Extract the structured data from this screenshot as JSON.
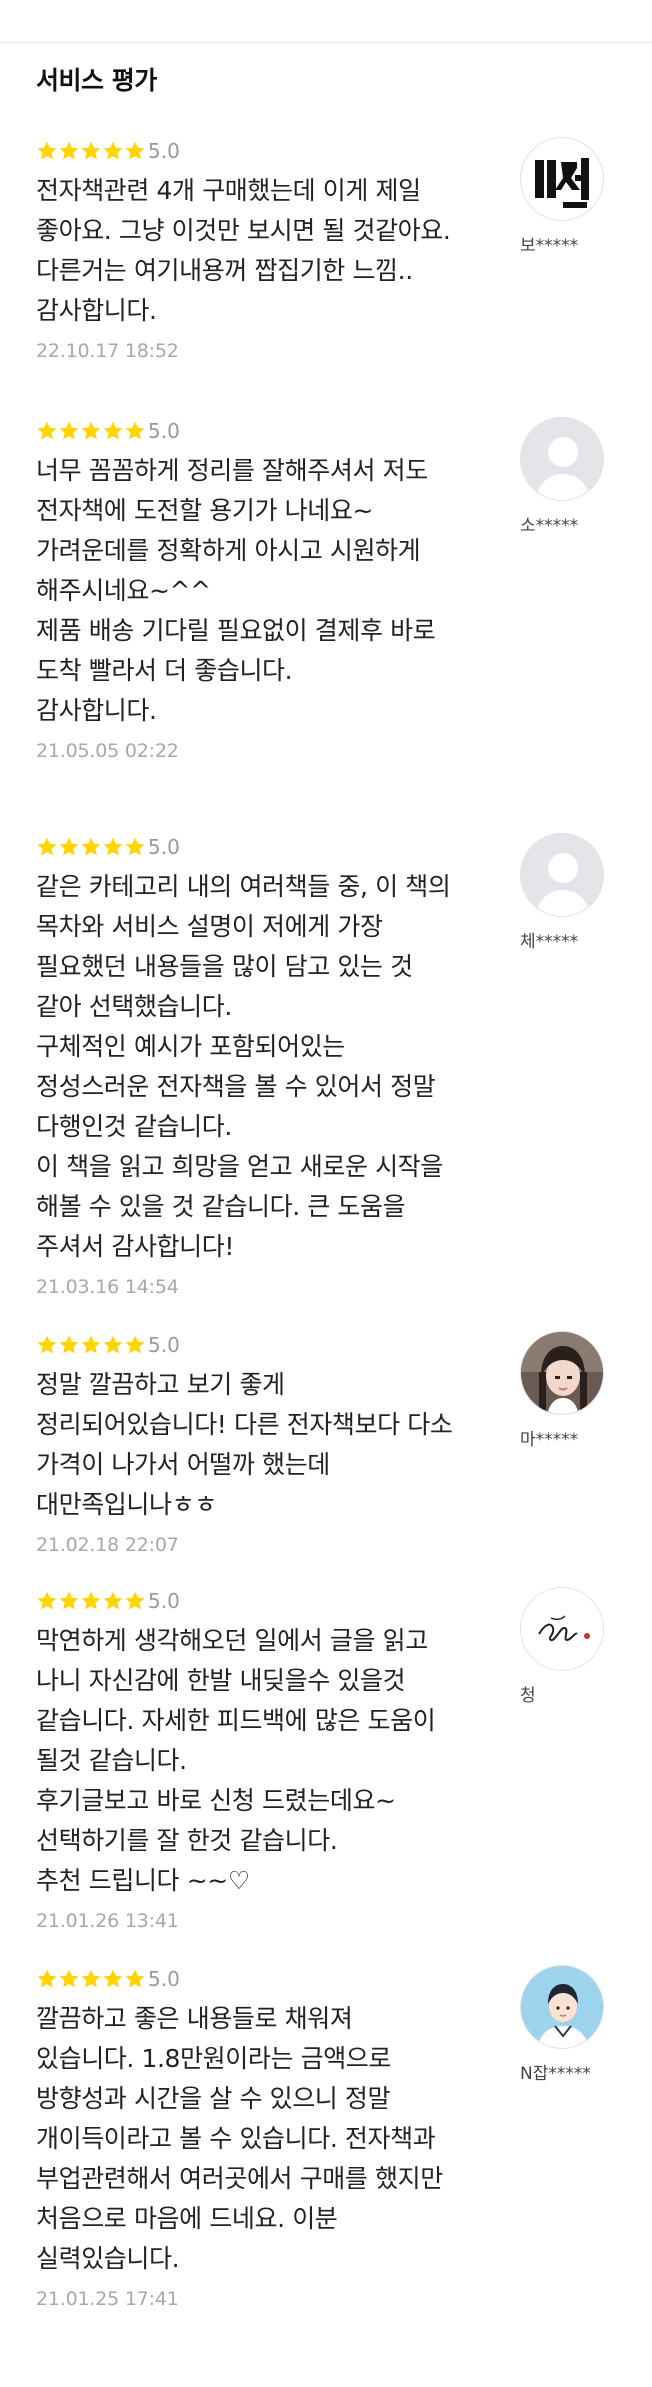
{
  "section_title": "서비스 평가",
  "colors": {
    "star": "#ffd400",
    "text": "#222222",
    "meta": "#a8a8a8"
  },
  "reviews": [
    {
      "score": "5.0",
      "stars": 5,
      "reviewer": "보*****",
      "avatar": "logo-avatar-icon",
      "lines": [
        "전자책관련 4개 구매했는데 이게 제일 좋아요. 그냥 이것만 보시면 될 것같아요. 다른거는 여기내용꺼 짭집기한 느낌.. 감사합니다."
      ],
      "date": "22.10.17 18:52"
    },
    {
      "score": "5.0",
      "stars": 5,
      "reviewer": "소*****",
      "avatar": "default-avatar-icon",
      "lines": [
        "너무 꼼꼼하게 정리를 잘해주셔서 저도 전자책에 도전할 용기가 나네요~ 가려운데를 정확하게 아시고 시원하게 해주시네요~^^",
        "제품 배송 기다릴 필요없이 결제후 바로 도착 빨라서 더 좋습니다.",
        "감사합니다."
      ],
      "date": "21.05.05 02:22"
    },
    {
      "score": "5.0",
      "stars": 5,
      "reviewer": "체*****",
      "avatar": "default-avatar-icon",
      "lines": [
        "같은 카테고리 내의 여러책들 중, 이 책의 목차와 서비스 설명이 저에게 가장 필요했던 내용들을 많이 담고 있는 것 같아 선택했습니다.",
        "구체적인 예시가 포함되어있는 정성스러운 전자책을 볼 수 있어서 정말 다행인것 같습니다.",
        "이 책을 읽고 희망을 얻고 새로운 시작을 해볼 수 있을 것 같습니다. 큰 도움을 주셔서 감사합니다!"
      ],
      "date": "21.03.16 14:54"
    },
    {
      "score": "5.0",
      "stars": 5,
      "reviewer": "마*****",
      "avatar": "photo-avatar-icon",
      "lines": [
        "정말 깔끔하고 보기 좋게 정리되어있습니다! 다른 전자책보다 다소 가격이 나가서 어떨까 했는데 대만족입니나ㅎㅎ"
      ],
      "date": "21.02.18 22:07"
    },
    {
      "score": "5.0",
      "stars": 5,
      "reviewer": "청",
      "avatar": "signature-avatar-icon",
      "lines": [
        "막연하게 생각해오던 일에서 글을 읽고 나니 자신감에 한발 내딪을수 있을것 같습니다. 자세한 피드백에 많은 도움이 될것 같습니다.",
        "후기글보고 바로 신청 드렸는데요~ 선택하기를 잘 한것 같습니다.",
        "추천 드립니다 ~~♡"
      ],
      "date": "21.01.26 13:41"
    },
    {
      "score": "5.0",
      "stars": 5,
      "reviewer": "N잡*****",
      "avatar": "illustration-avatar-icon",
      "lines": [
        "깔끔하고 좋은 내용들로 채워져 있습니다. 1.8만원이라는 금액으로 방향성과 시간을 살 수 있으니 정말 개이득이라고 볼 수 있습니다. 전자책과 부업관련해서 여러곳에서 구매를 했지만 처음으로 마음에 드네요. 이분 실력있습니다."
      ],
      "date": "21.01.25 17:41"
    }
  ]
}
